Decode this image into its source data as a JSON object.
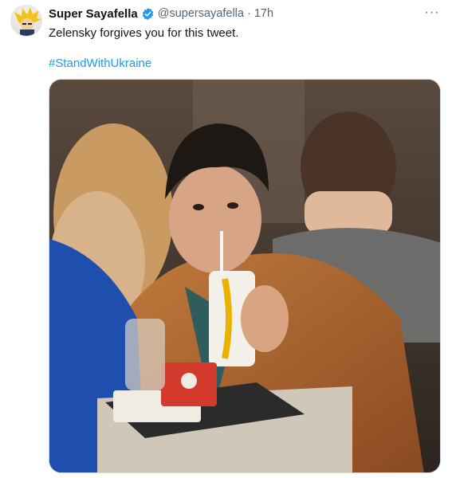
{
  "tweet": {
    "display_name": "Super Sayafella",
    "handle": "@supersayafella",
    "separator": "·",
    "time": "17h",
    "text": "Zelensky forgives you for this tweet.",
    "hashtag": "#StandWithUkraine",
    "more_label": "···"
  },
  "icons": {
    "avatar": "avatar-image",
    "verified": "verified-badge-icon",
    "more": "more-options-icon"
  },
  "colors": {
    "link": "#1d9bf0",
    "secondary_text": "#536471",
    "primary_text": "#0f1419",
    "verified": "#1d9bf0"
  }
}
